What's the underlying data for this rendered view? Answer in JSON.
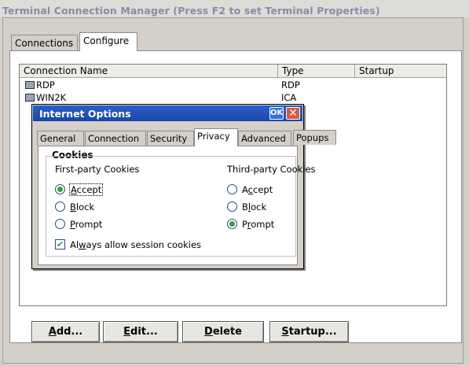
{
  "window": {
    "title": "Terminal Connection Manager (Press F2 to set Terminal Properties)"
  },
  "tabs": [
    "Connections",
    "Configure"
  ],
  "list": {
    "columns": [
      "Connection Name",
      "Type",
      "Startup"
    ],
    "rows": [
      {
        "name": "RDP",
        "type": "RDP",
        "startup": ""
      },
      {
        "name": "WIN2K",
        "type": "ICA",
        "startup": ""
      }
    ]
  },
  "buttons": {
    "add": {
      "mnemonic": "A",
      "rest": "dd..."
    },
    "edit": {
      "mnemonic": "E",
      "rest": "dit..."
    },
    "delete": {
      "mnemonic": "D",
      "rest": "elete"
    },
    "startup": {
      "mnemonic": "S",
      "rest": "tartup..."
    }
  },
  "dialog": {
    "title": "Internet Options",
    "ok_label": "OK",
    "close_label": "✕",
    "tabs": [
      "General",
      "Connection",
      "Security",
      "Privacy",
      "Advanced",
      "Popups"
    ],
    "active_tab": "Privacy",
    "group_title": "Cookies",
    "first_party": {
      "label": "First-party Cookies",
      "options": [
        {
          "mnemonic": "A",
          "rest": "ccept",
          "selected": true
        },
        {
          "mnemonic": "B",
          "rest": "lock",
          "selected": false
        },
        {
          "mnemonic": "P",
          "rest": "rompt",
          "selected": false
        }
      ]
    },
    "third_party": {
      "label": "Third-party Cookies",
      "options": [
        {
          "pre": "A",
          "mnemonic": "c",
          "rest": "cept",
          "selected": false
        },
        {
          "pre": "B",
          "mnemonic": "l",
          "rest": "ock",
          "selected": false
        },
        {
          "pre": "P",
          "mnemonic": "r",
          "rest": "ompt",
          "selected": true
        }
      ]
    },
    "session_cookies": {
      "pre": "Al",
      "mnemonic": "w",
      "rest": "ays allow session cookies",
      "checked": true
    }
  },
  "colors": {
    "titlebar": "#1b46a8",
    "selected_radio": "#2ea43a",
    "close_button": "#d65a3c"
  }
}
